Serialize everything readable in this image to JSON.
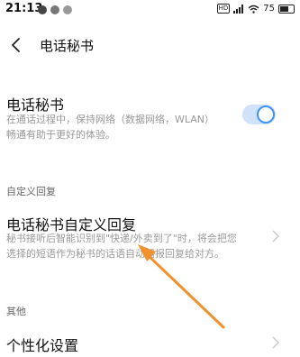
{
  "status_bar": {
    "time": "21:13",
    "signal_badge": "HD",
    "battery": "75",
    "battery_level": 0.75,
    "colors": {
      "icon_a": "#444444",
      "icon_b": "#777777",
      "icon_c": "#999999"
    }
  },
  "header": {
    "title": "电话秘书"
  },
  "phone_secretary": {
    "title": "电话秘书",
    "description_line1": "在通话过程中，保持网络（数据网络，WLAN）",
    "description_line2": "畅通有助于更好的体验。",
    "toggle_on": true
  },
  "custom_reply_section": {
    "header": "自定义回复",
    "item_title": "电话秘书自定义回复",
    "item_desc_line1": "秘书接听后智能识别到\"快递/外卖到了\"时，将会把您",
    "item_desc_line2": "选择的短语作为秘书的话语自动播报回复给对方。"
  },
  "other_section": {
    "header": "其他",
    "item_title": "个性化设置"
  },
  "colors": {
    "accent": "#3f93f1",
    "toggle_track": "#cfe2f7",
    "arrow": "#f0922e",
    "secondary_text": "#999999"
  },
  "icons": [
    "back-icon",
    "chevron-right-icon",
    "wifi-icon",
    "battery-icon"
  ]
}
